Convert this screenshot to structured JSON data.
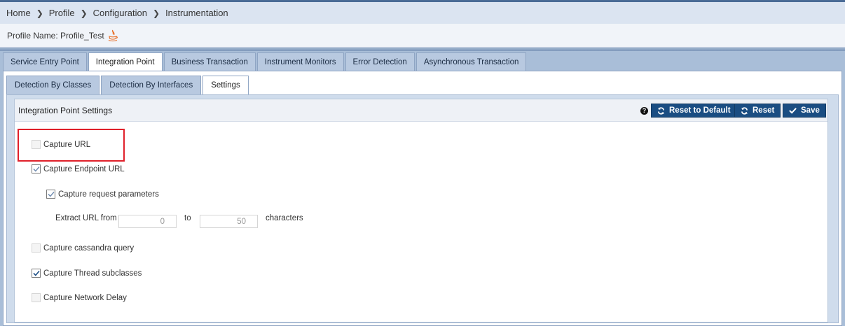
{
  "breadcrumb": {
    "items": [
      "Home",
      "Profile",
      "Configuration",
      "Instrumentation"
    ],
    "separator": ">"
  },
  "profile": {
    "label": "Profile Name: Profile_Test",
    "icon": "java-icon"
  },
  "main_tabs": [
    {
      "label": "Service Entry Point",
      "active": false
    },
    {
      "label": "Integration Point",
      "active": true
    },
    {
      "label": "Business Transaction",
      "active": false
    },
    {
      "label": "Instrument Monitors",
      "active": false
    },
    {
      "label": "Error Detection",
      "active": false
    },
    {
      "label": "Asynchronous Transaction",
      "active": false
    }
  ],
  "sub_tabs": [
    {
      "label": "Detection By Classes",
      "active": false
    },
    {
      "label": "Detection By Interfaces",
      "active": false
    },
    {
      "label": "Settings",
      "active": true
    }
  ],
  "panel": {
    "title": "Integration Point Settings",
    "help_icon": "question-circle-icon",
    "buttons": {
      "reset_default": "Reset to Default",
      "reset": "Reset",
      "save": "Save"
    }
  },
  "settings": {
    "capture_url": {
      "label": "Capture URL",
      "checked": false,
      "disabled": true
    },
    "capture_endpoint_url": {
      "label": "Capture Endpoint URL",
      "checked": true,
      "disabled": true
    },
    "capture_request_params": {
      "label": "Capture request parameters",
      "checked": true,
      "disabled": true
    },
    "extract_url": {
      "label": "Extract URL from",
      "from_value": "0",
      "to_label": "to",
      "to_value": "50",
      "suffix": "characters"
    },
    "capture_cassandra": {
      "label": "Capture cassandra query",
      "checked": false,
      "disabled": true
    },
    "capture_thread_subclasses": {
      "label": "Capture Thread subclasses",
      "checked": true,
      "disabled": false
    },
    "capture_network_delay": {
      "label": "Capture Network Delay",
      "checked": false,
      "disabled": true
    }
  },
  "colors": {
    "accent_button": "#1a4d82",
    "highlight": "#e0202a",
    "breadcrumb_bg": "#dbe4f1"
  }
}
